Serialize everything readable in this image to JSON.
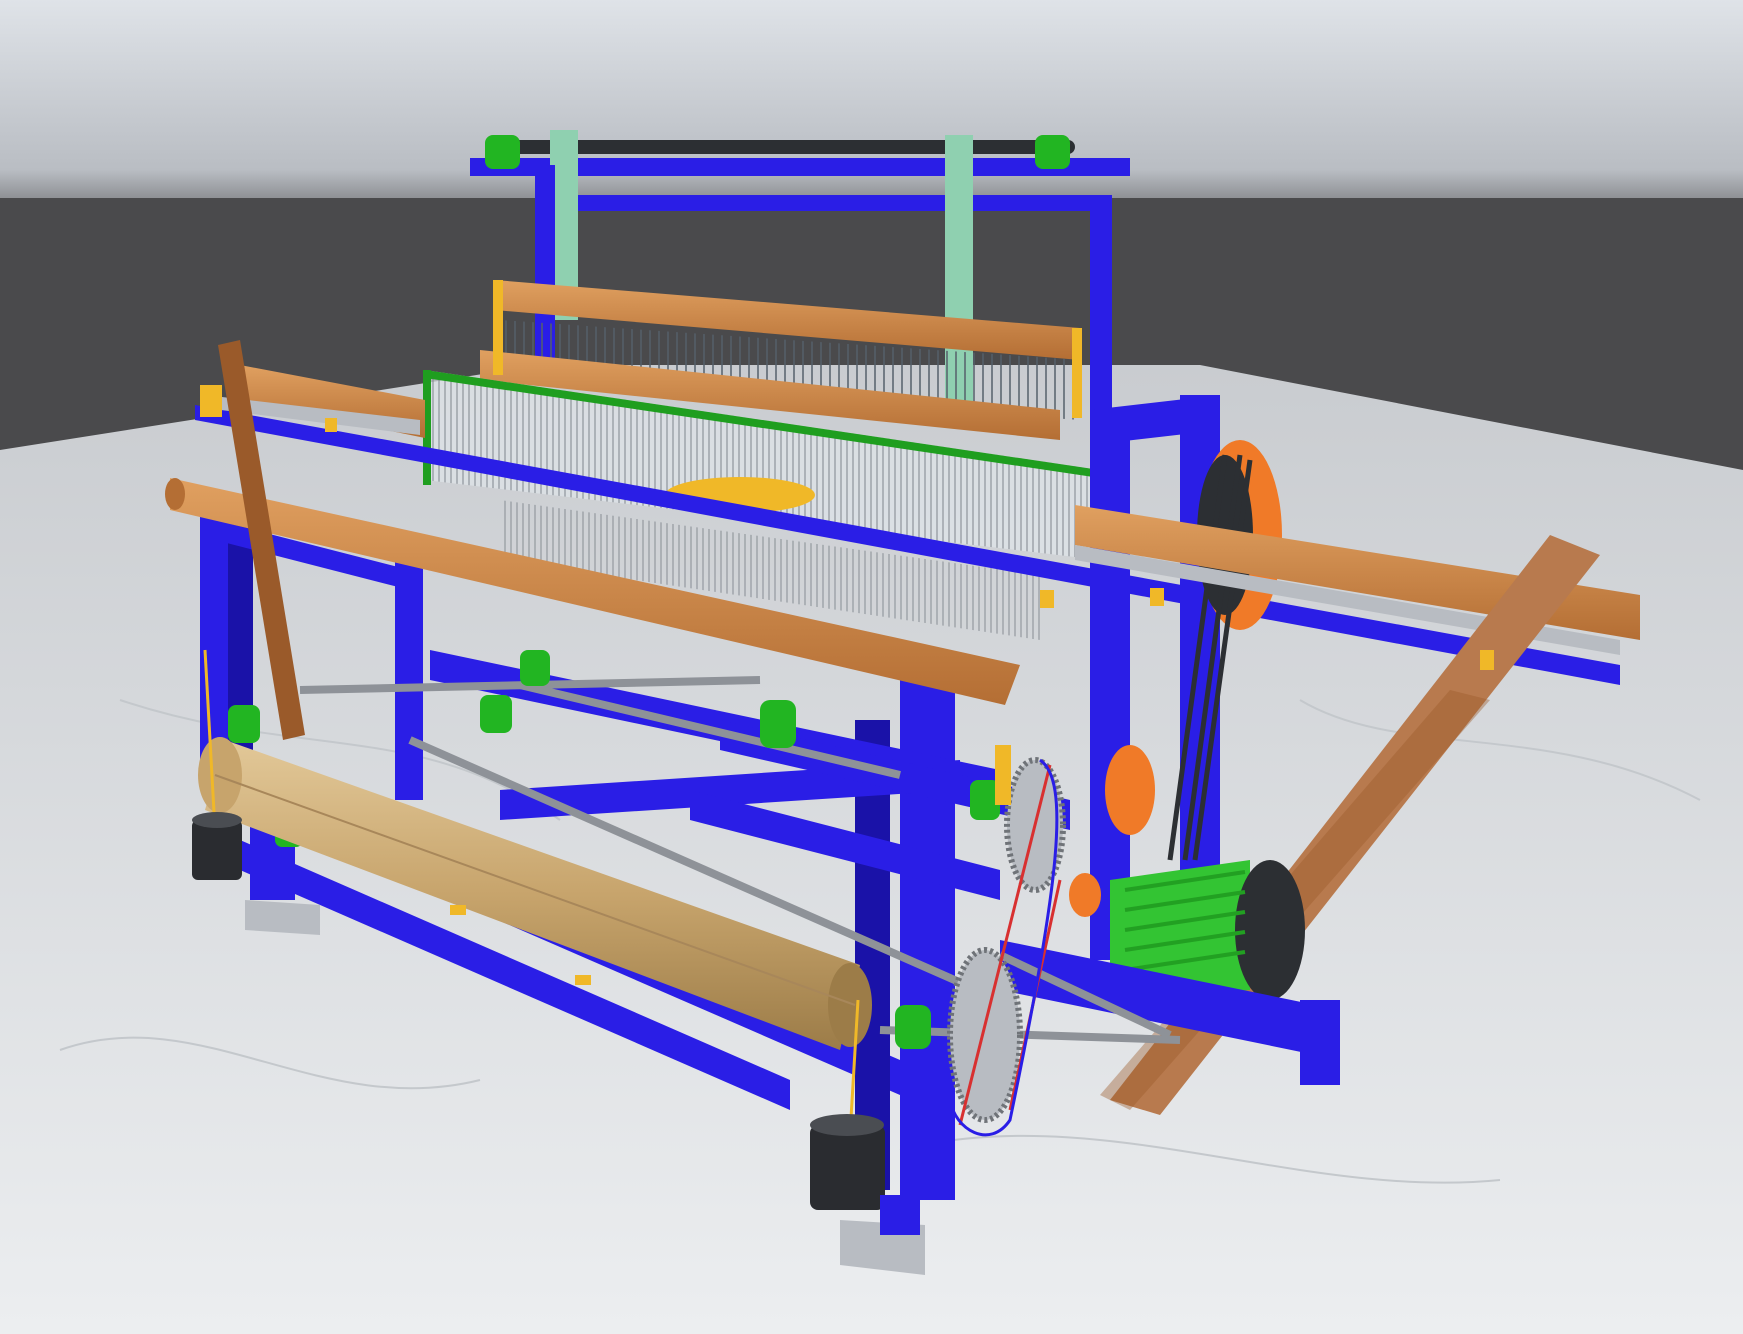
{
  "scene": {
    "kind": "3d-render",
    "subject": "power-loom",
    "colors": {
      "frame": "#2a1ee6",
      "frame_dark": "#1a12a8",
      "wood": "#c9854a",
      "wood_dark": "#9a5a2a",
      "cloth_roll": "#c9ad78",
      "bearing": "#22b522",
      "bracket": "#f0b828",
      "pulley": "#f07a28",
      "shaft": "#8e9298",
      "motor": "#33c433",
      "weight": "#2a2c30",
      "warp_frame": "#1f9e1f",
      "strap": "#8fd0b0",
      "lever": "#b87a4e",
      "floor": "#e2e4e6",
      "sky_top": "#d8dde4",
      "horizon_band": "#4a4a4c"
    },
    "components": [
      "top-roller",
      "heddle-frame",
      "reed-beater",
      "breast-beam",
      "cloth-roll",
      "side-pulley",
      "chain-sprocket",
      "electric-motor",
      "tension-weights",
      "treadle-lever"
    ]
  }
}
